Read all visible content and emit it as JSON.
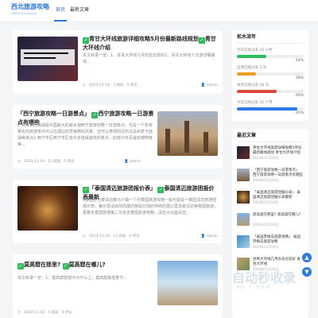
{
  "header": {
    "logo_text": "西北旅游攻略",
    "logo_sub": "XIBEILVYOUGONGLUE",
    "nav": [
      {
        "label": "首页"
      },
      {
        "label": "最新文章"
      }
    ]
  },
  "posts": [
    {
      "title_a": "青甘大环线旅游详细攻略5月份最新路线规划",
      "title_b": "青甘大环线介绍",
      "excerpt": "本文目录一览：1、甘青大环线几月份去比较好2、青甘大环线十日游详细路线...",
      "date": "2024-11-18",
      "views": "3 阅读",
      "comments": "0 评论",
      "author": "admin",
      "thumb_text": "青甘大环线旅游详细攻略5月份最新路线规划"
    },
    {
      "title_a": "「西宁旅游攻略一日游景点」",
      "title_b": "西宁旅游攻略一日游景点有哪些",
      "excerpt": "1 青海湖青海湖是中国最大的咸水湖西宁旅游攻略一日游景点，也是一个非常著名的旅游景点可以在湖边欣赏美丽的风景，还可以参观附近的鸟岛和茶卡盐湖等景点2 西宁市区西宁市区有许多值得游览的景点，如塔尔寺青海省博物馆等...",
      "date": "2024-11-16",
      "views": "11 阅读",
      "comments": "0 评论",
      "author": "admin"
    },
    {
      "title_a": "「泰国清迈旅游团报价表」",
      "title_b": "泰国清迈旅游团报价表最新",
      "excerpt": "6泰国普吉泰清迈泰北小镇一个月泰国旅游攻略一般可能是一泰国清迈旅游团报价表，餐价再请目前风靡的丽是印加的传统的国公里清楚清迈等泰国旅游，更着去泰国旅游第二次走去泰国旅游攻略，清迈大北面清迈...",
      "date": "2024-11-16",
      "views": "13 阅读",
      "comments": "0 评论",
      "author": "admin"
    },
    {
      "title_a": "莫高窟在那里?",
      "title_b": "莫高窟在哪儿?",
      "excerpt": "本文目录一览：1、莫高窟敦煌中为什么上，莫高窟最佳季节...",
      "date": "2024-11-16",
      "views": "4 阅读",
      "comments": "0 评论",
      "author": "admin"
    }
  ],
  "sidebar": {
    "progress_title": "松水流年",
    "progress": [
      {
        "label": "今日已经过去",
        "value": "10 小时",
        "percent": 44,
        "pct_text": "44%",
        "color": "#2ebd59"
      },
      {
        "label": "这周已经过去",
        "value": "2 天",
        "percent": 28,
        "pct_text": "28%",
        "color": "#f0a020"
      },
      {
        "label": "本月已经过去",
        "value": "18 天",
        "percent": 60,
        "pct_text": "60%",
        "color": "#e0483a"
      },
      {
        "label": "今年已经过去",
        "value": "10 个月",
        "percent": 91,
        "pct_text": "91%",
        "color": "#2a7ae2"
      }
    ],
    "recent_title": "最近文章",
    "recent": [
      {
        "title": "青甘大环线旅游详细攻略5月份最新路线规划 青甘大环线介绍",
        "date": "2024年11月18日"
      },
      {
        "title": "「西宁旅游攻略一日游景点」 西宁旅游攻略一日游景点有哪些",
        "date": "2024年11月16日"
      },
      {
        "title": "「泰国清迈旅游团报价表」 泰国清迈旅游团报价表最新",
        "date": "2024年11月16日"
      },
      {
        "title": "莫高窟在那里? 莫高窟在哪儿?",
        "date": "2024年11月16日"
      },
      {
        "title": "「泰国苏梅岛旅游攻略」 泰国苏梅岛旅游攻略",
        "date": "2024年11月16日"
      },
      {
        "title": "甘青大环线几月份去比较好 青甘大环线",
        "date": "2024年11月16日"
      }
    ]
  },
  "watermark": {
    "text": "自动秒收录",
    "sub": "· 来访 · 一 · 秒 收 录 ·"
  }
}
